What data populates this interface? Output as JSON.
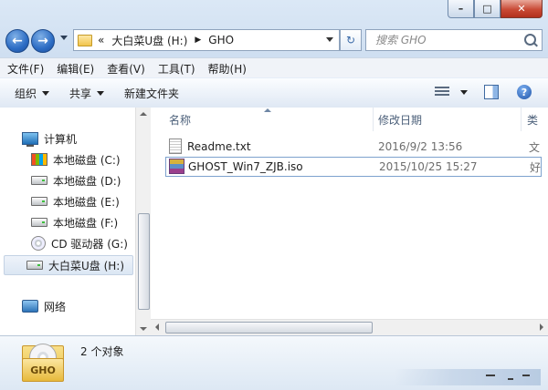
{
  "address": {
    "back_glyph": "«",
    "crumbs": [
      "大白菜U盘 (H:)",
      "GHO"
    ],
    "separator": "▶"
  },
  "search": {
    "placeholder": "搜索 GHO"
  },
  "menu": [
    "文件(F)",
    "编辑(E)",
    "查看(V)",
    "工具(T)",
    "帮助(H)"
  ],
  "commands": {
    "organize": "组织",
    "share": "共享",
    "new_folder": "新建文件夹",
    "help": "?"
  },
  "nav_tree": {
    "computer": "计算机",
    "drives": [
      "本地磁盘 (C:)",
      "本地磁盘 (D:)",
      "本地磁盘 (E:)",
      "本地磁盘 (F:)",
      "CD 驱动器 (G:)",
      "大白菜U盘 (H:)"
    ],
    "selected_drive": "大白菜U盘 (H:)",
    "network": "网络"
  },
  "columns": [
    "名称",
    "修改日期",
    "类"
  ],
  "files": [
    {
      "name": "Readme.txt",
      "date": "2016/9/2 13:56",
      "type": "文",
      "icon": "text-file-icon"
    },
    {
      "name": "GHOST_Win7_ZJB.iso",
      "date": "2015/10/25 15:27",
      "type": "好",
      "icon": "archive-icon"
    }
  ],
  "details": {
    "count": "2 个对象",
    "folder_label": "GHO"
  },
  "colors": {
    "selection_border": "#7da2ce",
    "window_bg": "#dbe8f6",
    "close_button": "#c94a35"
  }
}
